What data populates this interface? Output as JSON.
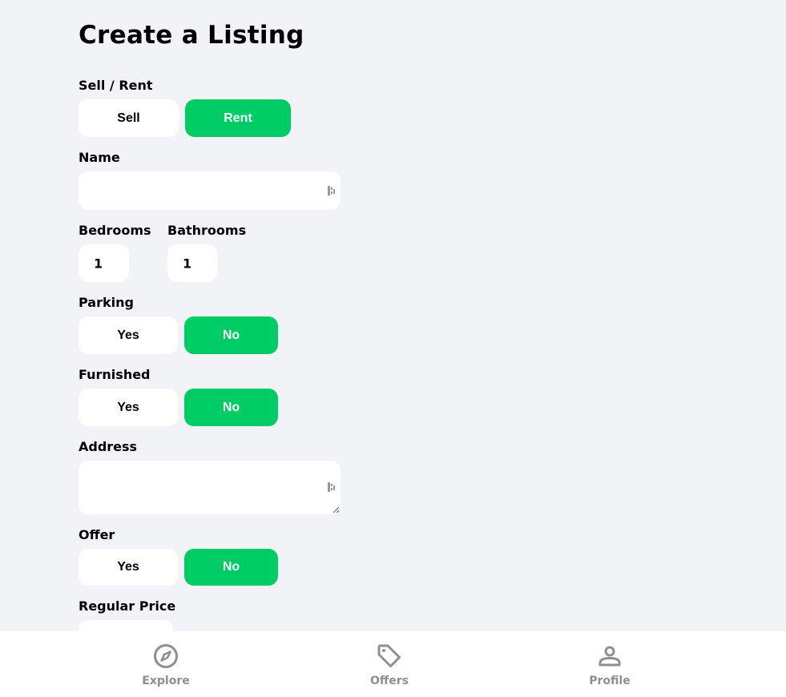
{
  "page_title": "Create a Listing",
  "sell_rent": {
    "label": "Sell / Rent",
    "sell_label": "Sell",
    "rent_label": "Rent",
    "selected": "Rent"
  },
  "name": {
    "label": "Name",
    "value": ""
  },
  "bedrooms": {
    "label": "Bedrooms",
    "value": "1"
  },
  "bathrooms": {
    "label": "Bathrooms",
    "value": "1"
  },
  "parking": {
    "label": "Parking",
    "yes_label": "Yes",
    "no_label": "No",
    "selected": "No"
  },
  "furnished": {
    "label": "Furnished",
    "yes_label": "Yes",
    "no_label": "No",
    "selected": "No"
  },
  "address": {
    "label": "Address",
    "value": ""
  },
  "offer": {
    "label": "Offer",
    "yes_label": "Yes",
    "no_label": "No",
    "selected": "No"
  },
  "regular_price": {
    "label": "Regular Price"
  },
  "navbar": {
    "items": [
      {
        "label": "Explore",
        "icon": "compass-icon"
      },
      {
        "label": "Offers",
        "icon": "tag-icon"
      },
      {
        "label": "Profile",
        "icon": "person-icon"
      }
    ]
  },
  "colors": {
    "accent": "#00cc66",
    "background": "#f2f3f6",
    "nav_text": "#8f8f8f"
  }
}
